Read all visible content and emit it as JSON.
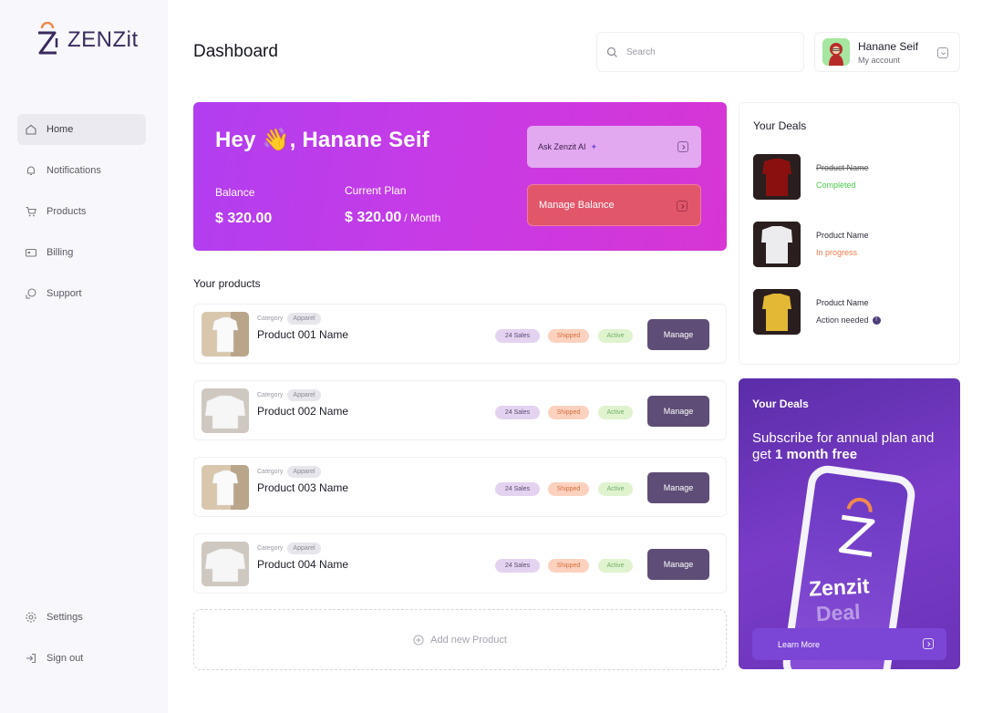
{
  "brand": {
    "name": "ZENZit"
  },
  "sidebar": {
    "items": [
      {
        "label": "Home",
        "icon": "home-icon",
        "active": true
      },
      {
        "label": "Notifications",
        "icon": "bell-icon"
      },
      {
        "label": "Products",
        "icon": "cart-icon"
      },
      {
        "label": "Billing",
        "icon": "card-icon"
      },
      {
        "label": "Support",
        "icon": "support-icon"
      }
    ],
    "bottom": [
      {
        "label": "Settings",
        "icon": "gear-icon"
      },
      {
        "label": "Sign out",
        "icon": "signout-icon"
      }
    ]
  },
  "header": {
    "title": "Dashboard",
    "search_placeholder": "Search",
    "account": {
      "name": "Hanane Seif",
      "sub": "My account"
    }
  },
  "hero": {
    "greeting": "Hey 👋, Hanane Seif",
    "balance_label": "Balance",
    "balance_value": "$ 320.00",
    "plan_label": "Current Plan",
    "plan_value": "$ 320.00",
    "plan_period": "/ Month",
    "ask_label": "Ask Zenzit AI",
    "manage_label": "Manage Balance"
  },
  "products": {
    "title": "Your products",
    "category_label": "Category",
    "items": [
      {
        "name": "Product 001 Name",
        "category": "Apparel",
        "sales": "24 Sales",
        "shipping": "Shipped",
        "status": "Active",
        "action": "Manage"
      },
      {
        "name": "Product 002 Name",
        "category": "Apparel",
        "sales": "24 Sales",
        "shipping": "Shipped",
        "status": "Active",
        "action": "Manage"
      },
      {
        "name": "Product 003 Name",
        "category": "Apparel",
        "sales": "24 Sales",
        "shipping": "Shipped",
        "status": "Active",
        "action": "Manage"
      },
      {
        "name": "Product 004 Name",
        "category": "Apparel",
        "sales": "24 Sales",
        "shipping": "Shipped",
        "status": "Active",
        "action": "Manage"
      }
    ],
    "add_label": "Add new Product"
  },
  "deals": {
    "title": "Your Deals",
    "items": [
      {
        "name": "Product Name",
        "status": "Completed",
        "status_color": "#4cc94c",
        "image_color": "#8a1010"
      },
      {
        "name": "Product Name",
        "status": "In progress",
        "status_color": "#f07a4a",
        "image_color": "#e8e8ea"
      },
      {
        "name": "Product Name",
        "status": "Action needed",
        "status_color": "#3a3a46",
        "image_color": "#e2b834"
      }
    ]
  },
  "promo": {
    "title": "Your Deals",
    "text_prefix": "Subscribe for annual plan and get",
    "text_bold": "1 month free",
    "brand": "Zenzit",
    "deal": "Deal",
    "button": "Learn More"
  },
  "colors": {
    "accent": "#5e4d76",
    "hero_start": "#b13ef0",
    "hero_end": "#d735d4",
    "promo": "#6a33b8"
  }
}
